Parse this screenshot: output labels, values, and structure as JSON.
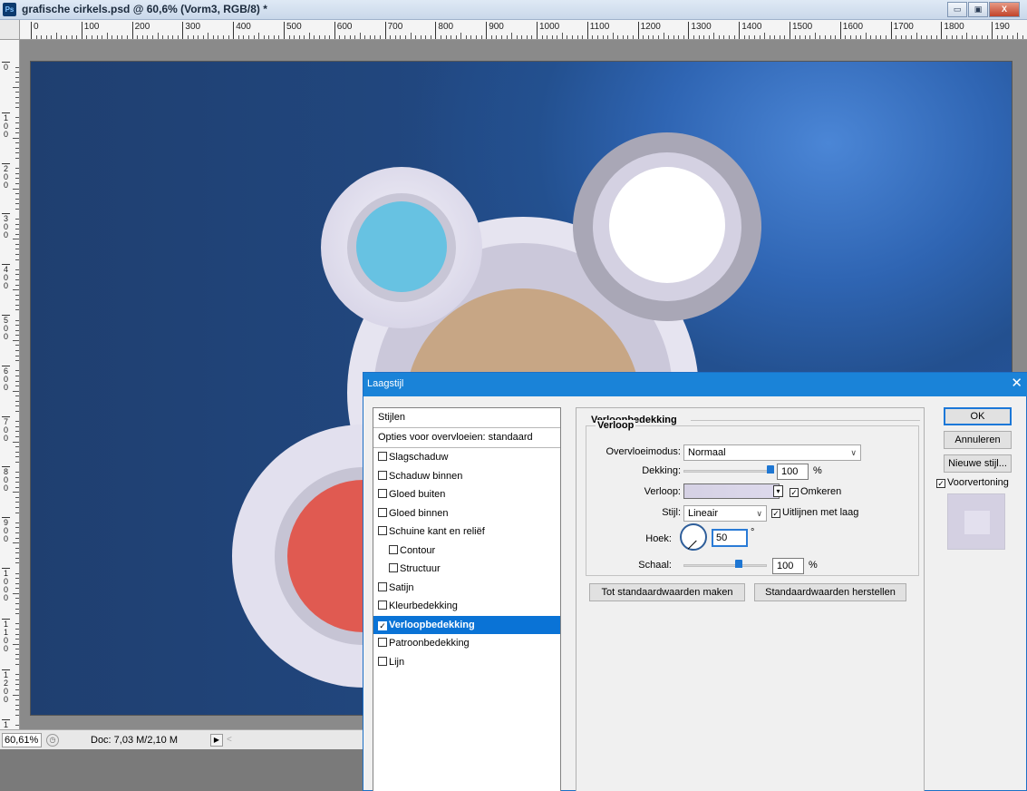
{
  "window": {
    "app_badge": "Ps",
    "title": "grafische cirkels.psd @ 60,6% (Vorm3, RGB/8) *",
    "minimize_glyph": "▭",
    "maximize_glyph": "▣",
    "close_glyph": "X"
  },
  "ruler": {
    "h_labels": [
      "0",
      "100",
      "200",
      "300",
      "400",
      "500",
      "600",
      "700",
      "800",
      "900",
      "1000",
      "1100",
      "1200",
      "1300",
      "1400",
      "1500",
      "1600",
      "1700",
      "1800",
      "190"
    ],
    "v_labels": [
      "0",
      "100",
      "200",
      "300",
      "400",
      "500",
      "600",
      "700",
      "800",
      "900",
      "1000",
      "1100",
      "1200",
      "1300"
    ]
  },
  "status": {
    "zoom": "60,61%",
    "zoom_icon": "◷",
    "doc_info": "Doc: 7,03 M/2,10 M",
    "arrow_glyph": "▶",
    "scroll_glyph": "<"
  },
  "dialog": {
    "title": "Laagstijl",
    "close_glyph": "✕",
    "styles_header": "Stijlen",
    "blend_options": "Opties voor overvloeien: standaard",
    "style_items": [
      {
        "label": "Slagschaduw",
        "checked": false,
        "sub": false,
        "selected": false
      },
      {
        "label": "Schaduw binnen",
        "checked": false,
        "sub": false,
        "selected": false
      },
      {
        "label": "Gloed buiten",
        "checked": false,
        "sub": false,
        "selected": false
      },
      {
        "label": "Gloed binnen",
        "checked": false,
        "sub": false,
        "selected": false
      },
      {
        "label": "Schuine kant en reliëf",
        "checked": false,
        "sub": false,
        "selected": false
      },
      {
        "label": "Contour",
        "checked": false,
        "sub": true,
        "selected": false
      },
      {
        "label": "Structuur",
        "checked": false,
        "sub": true,
        "selected": false
      },
      {
        "label": "Satijn",
        "checked": false,
        "sub": false,
        "selected": false
      },
      {
        "label": "Kleurbedekking",
        "checked": false,
        "sub": false,
        "selected": false
      },
      {
        "label": "Verloopbedekking",
        "checked": true,
        "sub": false,
        "selected": true
      },
      {
        "label": "Patroonbedekking",
        "checked": false,
        "sub": false,
        "selected": false
      },
      {
        "label": "Lijn",
        "checked": false,
        "sub": false,
        "selected": false
      }
    ],
    "section_title": "Verloopbedekking",
    "group_title": "Verloop",
    "blend_mode_label": "Overvloeimodus:",
    "blend_mode_value": "Normaal",
    "opacity_label": "Dekking:",
    "opacity_value": "100",
    "opacity_unit": "%",
    "opacity_fraction": 1.0,
    "gradient_label": "Verloop:",
    "reverse_label": "Omkeren",
    "reverse_checked": true,
    "style_label": "Stijl:",
    "style_value": "Lineair",
    "align_label": "Uitlijnen met laag",
    "align_checked": true,
    "angle_label": "Hoek:",
    "angle_value": "50",
    "angle_unit": "°",
    "scale_label": "Schaal:",
    "scale_value": "100",
    "scale_unit": "%",
    "scale_fraction": 0.67,
    "make_default": "Tot standaardwaarden maken",
    "reset_default": "Standaardwaarden herstellen",
    "ok": "OK",
    "cancel": "Annuleren",
    "new_style": "Nieuwe stijl...",
    "preview_label": "Voorvertoning",
    "preview_checked": true,
    "chevron_glyph": "∨",
    "check_glyph": "✓",
    "swatch_arrow_glyph": "▾"
  },
  "colors": {
    "dialog_accent": "#1a83d8",
    "selected_row": "#0a73d6",
    "circle_blue": "#67c2e2",
    "circle_tan": "#c7a685",
    "circle_red": "#e05a51",
    "circle_white": "#ffffff",
    "ring_light": "#e2e0ee",
    "ring_gray": "#a9a7b6"
  }
}
